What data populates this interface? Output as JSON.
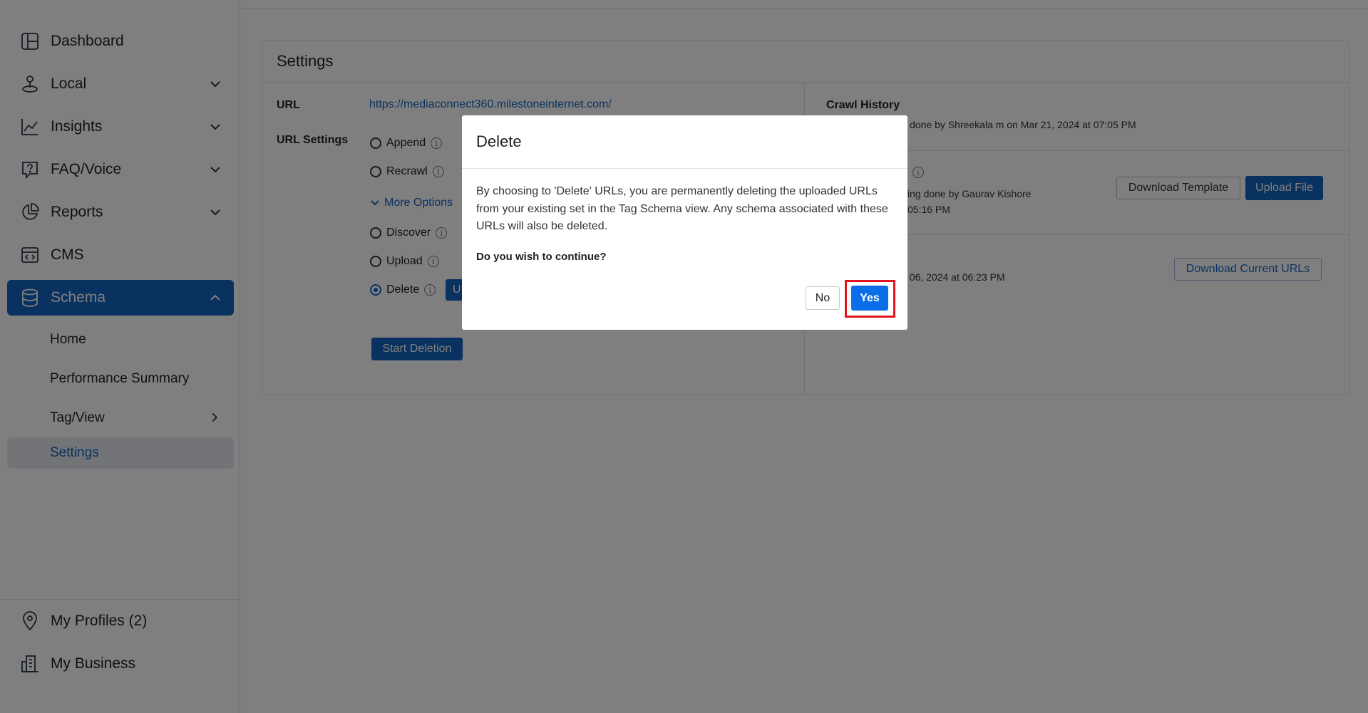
{
  "sidebar": {
    "items": [
      {
        "label": "Dashboard",
        "icon": "dashboard-icon"
      },
      {
        "label": "Local",
        "icon": "location-person-icon"
      },
      {
        "label": "Insights",
        "icon": "line-chart-icon"
      },
      {
        "label": "FAQ/Voice",
        "icon": "faq-voice-icon"
      },
      {
        "label": "Reports",
        "icon": "pie-chart-icon"
      },
      {
        "label": "CMS",
        "icon": "cms-icon"
      },
      {
        "label": "Schema",
        "icon": "database-icon"
      }
    ],
    "schema_sub": [
      {
        "label": "Home"
      },
      {
        "label": "Performance Summary"
      },
      {
        "label": "Tag/View"
      },
      {
        "label": "Settings"
      }
    ],
    "bottom": [
      {
        "label": "My Profiles (2)",
        "icon": "map-pin-icon"
      },
      {
        "label": "My Business",
        "icon": "building-icon"
      }
    ]
  },
  "settings": {
    "title": "Settings",
    "url_label": "URL",
    "url_value": "https://mediaconnect360.milestoneinternet.com/",
    "url_settings_label": "URL Settings",
    "options": {
      "append": "Append",
      "recrawl": "Recrawl",
      "more_options": "More Options",
      "discover": "Discover",
      "upload": "Upload",
      "delete": "Delete"
    },
    "selected_option": "Delete",
    "partial_button": "U",
    "start_deletion": "Start Deletion"
  },
  "crawl_history": {
    "title": "Crawl History",
    "entry1": "wl done by Shreekala m on Mar 21, 2024 at 07:05 PM",
    "entry2_line1": "ing done by Gaurav Kishore",
    "entry2_line2": "05:16 PM",
    "entry3": "t 06, 2024 at 06:23 PM",
    "download_template": "Download Template",
    "upload_file": "Upload File",
    "download_current_urls": "Download Current URLs"
  },
  "modal": {
    "title": "Delete",
    "body": "By choosing to 'Delete' URLs, you are permanently deleting the uploaded URLs from your existing set in the Tag Schema view. Any schema associated with these URLs will also be deleted.",
    "question": "Do you wish to continue?",
    "no_label": "No",
    "yes_label": "Yes"
  },
  "colors": {
    "accent": "#1565c0",
    "yes_button": "#0b6ee8",
    "highlight": "#e0141e"
  }
}
